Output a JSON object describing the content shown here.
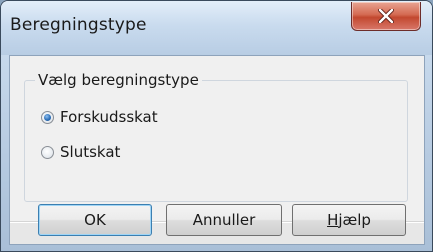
{
  "window": {
    "title": "Beregningstype",
    "close_symbol": "×"
  },
  "group": {
    "legend": "Vælg beregningstype",
    "options": [
      {
        "label": "Forskudsskat",
        "checked": true
      },
      {
        "label": "Slutskat",
        "checked": false
      }
    ]
  },
  "buttons": {
    "ok": "OK",
    "cancel": "Annuller",
    "help_mnemonic": "H",
    "help_rest": "jælp"
  }
}
